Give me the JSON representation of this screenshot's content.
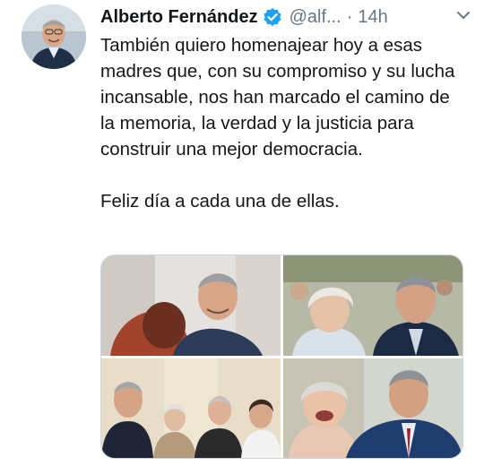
{
  "tweet": {
    "author_name": "Alberto Fernández",
    "handle": "@alf...",
    "separator": "·",
    "time": "14h",
    "paragraphs": [
      "También quiero homenajear hoy a esas madres que, con su compromiso y su lucha incansable, nos han marcado el camino de la memoria, la verdad y la justicia para construir una mejor democracia.",
      "Feliz día a cada una de ellas."
    ],
    "icons": {
      "verified": "verified-badge-icon",
      "menu": "chevron-down-icon"
    },
    "colors": {
      "verified": "#1da1f2",
      "secondary_text": "#657786",
      "primary_text": "#14171a"
    },
    "media": [
      {
        "name": "photo-1"
      },
      {
        "name": "photo-2"
      },
      {
        "name": "photo-3"
      },
      {
        "name": "photo-4"
      }
    ]
  }
}
